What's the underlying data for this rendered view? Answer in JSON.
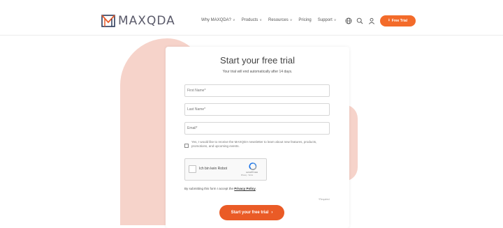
{
  "header": {
    "logo_text": "MAXQDA",
    "nav": [
      {
        "label": "Why MAXQDA?",
        "has_dropdown": true
      },
      {
        "label": "Products",
        "has_dropdown": true
      },
      {
        "label": "Resources",
        "has_dropdown": true
      },
      {
        "label": "Pricing",
        "has_dropdown": false
      },
      {
        "label": "Support",
        "has_dropdown": true
      }
    ],
    "icons": [
      "globe-icon",
      "search-icon",
      "user-icon"
    ],
    "trial_button": "Free Trial",
    "accent_color": "#f36b2a"
  },
  "form": {
    "title": "Start your free trial",
    "subtitle": "Your trial will end automatically after 14 days.",
    "first_name_placeholder": "First Name*",
    "last_name_placeholder": "Last Name*",
    "email_placeholder": "Email*",
    "consent_text": "Yes, I would like to receive the MAXQDA newsletter to learn about new features, products, promotions, and upcoming events.",
    "captcha_label": "Ich bin kein Robot",
    "captcha_brand": "reCAPTCHA",
    "captcha_links": "Privacy - Terms",
    "privacy_prefix": "By submitting this form I accept the ",
    "privacy_link": "Privacy Policy",
    "privacy_suffix": ".",
    "required_note": "*Required",
    "submit_label": "Start your free trial",
    "background_blob_color": "#f6d3ca"
  }
}
